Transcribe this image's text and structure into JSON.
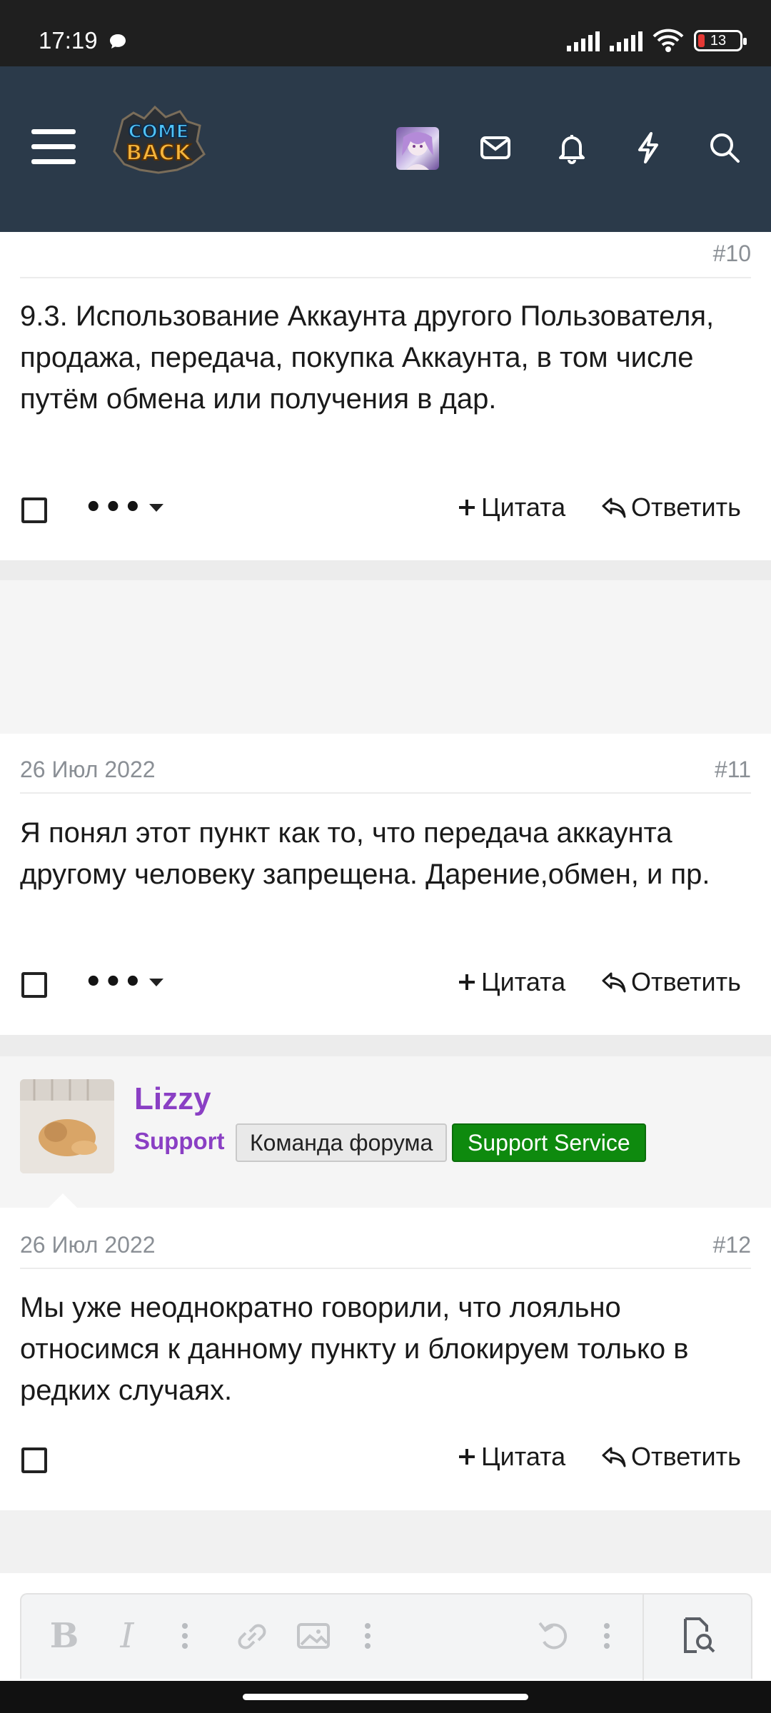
{
  "status_bar": {
    "time": "17:19",
    "battery": "13",
    "icons": [
      "message-bubble-icon",
      "signal-icon",
      "signal-icon",
      "wifi-icon",
      "battery-icon"
    ]
  },
  "header": {
    "logo_text": "COME BACK",
    "icons": [
      "menu-icon",
      "avatar",
      "mail-icon",
      "bell-icon",
      "lightning-icon",
      "search-icon"
    ]
  },
  "posts": [
    {
      "number": "#10",
      "body": "9.3. Использование Аккаунта другого Пользователя, продажа, передача, покупка Аккаунта, в том числе путём обмена или получения в дар.",
      "quote_label": "Цитата",
      "reply_label": "Ответить",
      "more_label": "•••"
    },
    {
      "date": "26 Июл 2022",
      "number": "#11",
      "body": "Я понял этот пункт как то, что передача аккаунта другому человеку запрещена. Дарение,обмен, и пр.",
      "quote_label": "Цитата",
      "reply_label": "Ответить",
      "more_label": "•••"
    },
    {
      "author": "Lizzy",
      "role": "Support",
      "badges": [
        "Команда форума",
        "Support Service"
      ],
      "date": "26 Июл 2022",
      "number": "#12",
      "body": "Мы уже неоднократно говорили, что лояльно относимся к данному пункту и блокируем только в редких случаях.",
      "quote_label": "Цитата",
      "reply_label": "Ответить"
    }
  ],
  "editor": {
    "tools": [
      "bold-icon",
      "italic-icon",
      "more-vertical-icon",
      "link-icon",
      "image-icon",
      "more-vertical-icon",
      "undo-icon",
      "more-vertical-icon",
      "preview-icon"
    ],
    "bold_label": "B",
    "italic_label": "I"
  },
  "colors": {
    "header_bg": "#2b3a4a",
    "accent_purple": "#8a3fc4",
    "support_badge": "#0e8a0e"
  }
}
